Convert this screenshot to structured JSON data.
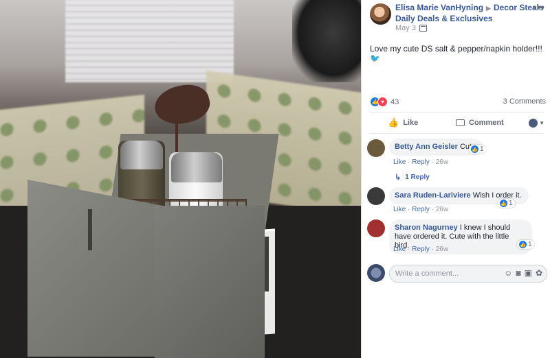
{
  "post": {
    "author": "Elisa Marie VanHyning",
    "group_name": "Decor Steals",
    "group_subtitle": "Daily Deals & Exclusives",
    "date": "May 3",
    "text": "Love my cute DS salt & pepper/napkin holder!!!",
    "reaction_count": "43",
    "comment_count": "3 Comments"
  },
  "actions": {
    "like_label": "Like",
    "comment_label": "Comment"
  },
  "comments": [
    {
      "name": "Betty Ann Geisler",
      "text": "Cute",
      "like": "Like",
      "reply": "Reply",
      "age": "26w",
      "reactions": "1",
      "replies_label": "1 Reply",
      "avatar_color": "#6b5a3c"
    },
    {
      "name": "Sara Ruden-Lariviere",
      "text": "Wish I order it.",
      "like": "Like",
      "reply": "Reply",
      "age": "26w",
      "reactions": "1",
      "avatar_color": "#3a3a3a"
    },
    {
      "name": "Sharon Nagurney",
      "text": "I knew I should have ordered it. Cute with the little bird.",
      "like": "Like",
      "reply": "Reply",
      "age": "26w",
      "reactions": "1",
      "avatar_color": "#a33030"
    }
  ],
  "writer": {
    "placeholder": "Write a comment..."
  },
  "icons": [
    "more-icon",
    "globe-icon",
    "like-reaction-icon",
    "love-reaction-icon",
    "thumb-icon",
    "comment-bubble-icon",
    "caret-down-icon",
    "reply-arrow-icon",
    "emoji-icon",
    "camera-icon",
    "gif-icon",
    "sticker-icon"
  ],
  "colors": {
    "link_blue": "#365899",
    "action_blue": "#4267b2",
    "like_blue": "#1877f2",
    "love_red": "#f33e58"
  }
}
